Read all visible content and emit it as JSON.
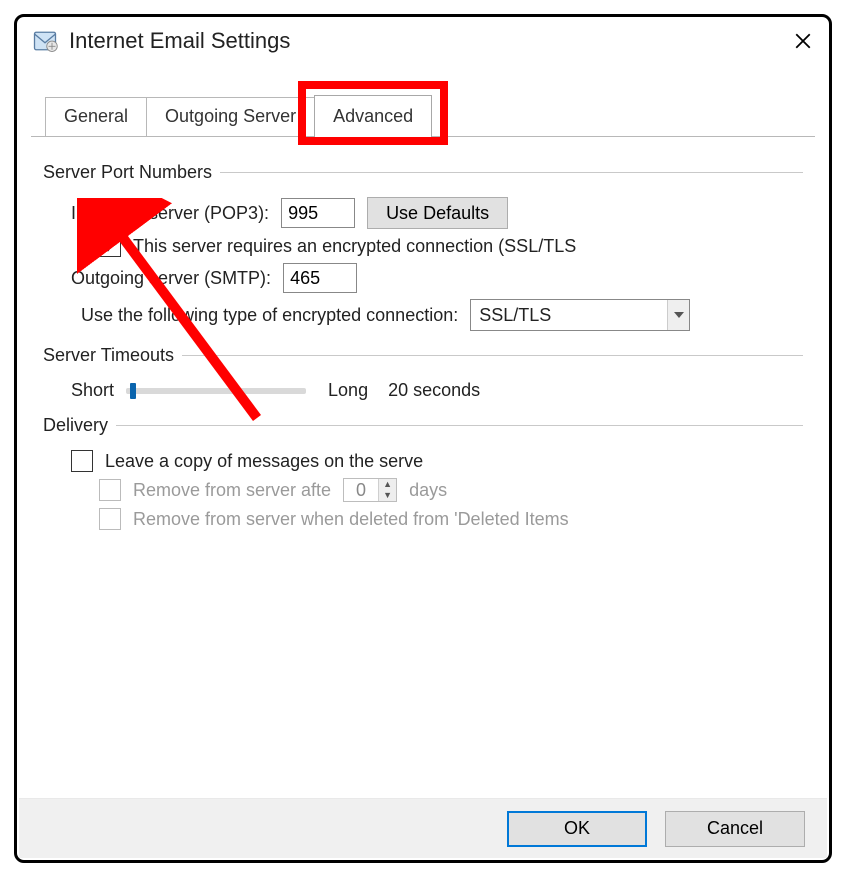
{
  "title": "Internet Email Settings",
  "tabs": {
    "general": "General",
    "outgoing": "Outgoing Server",
    "advanced": "Advanced"
  },
  "server_ports": {
    "legend": "Server Port Numbers",
    "incoming_label": "Incoming server (POP3):",
    "incoming_value": "995",
    "defaults_btn": "Use Defaults",
    "ssl_check_label": "This server requires an encrypted connection (SSL/TLS",
    "ssl_checked": true,
    "outgoing_label": "Outgoing server (SMTP):",
    "outgoing_value": "465",
    "enc_label": "Use the following type of encrypted connection:",
    "enc_value": "SSL/TLS"
  },
  "timeouts": {
    "legend": "Server Timeouts",
    "short": "Short",
    "long": "Long",
    "value": "20 seconds"
  },
  "delivery": {
    "legend": "Delivery",
    "leave_copy": "Leave a copy of messages on the serve",
    "remove_after_prefix": "Remove from server afte",
    "remove_after_days_value": "0",
    "remove_after_suffix": "days",
    "remove_deleted": "Remove from server when deleted from 'Deleted Items"
  },
  "buttons": {
    "ok": "OK",
    "cancel": "Cancel"
  },
  "annotation": {
    "highlight_tab": "advanced",
    "arrow_target": "ssl-checkbox"
  }
}
